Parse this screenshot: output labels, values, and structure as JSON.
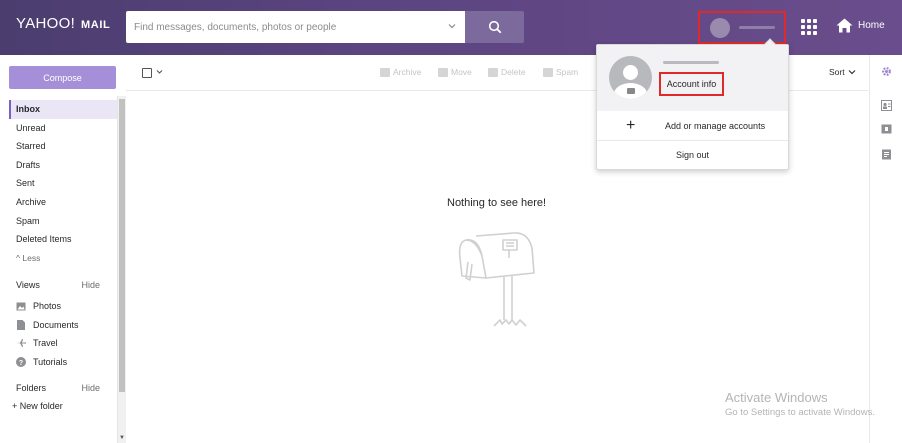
{
  "header": {
    "logo_text": "YAHOO!",
    "logo_mail": "MAIL",
    "search_placeholder": "Find messages, documents, photos or people",
    "home_label": "Home"
  },
  "sidebar": {
    "compose_label": "Compose",
    "items": [
      {
        "label": "Inbox",
        "active": true
      },
      {
        "label": "Unread"
      },
      {
        "label": "Starred"
      },
      {
        "label": "Drafts"
      },
      {
        "label": "Sent"
      },
      {
        "label": "Archive"
      },
      {
        "label": "Spam"
      },
      {
        "label": "Deleted Items"
      }
    ],
    "less_label": "Less",
    "views_label": "Views",
    "views_hide": "Hide",
    "views": [
      {
        "label": "Photos",
        "icon": "photo-icon"
      },
      {
        "label": "Documents",
        "icon": "document-icon"
      },
      {
        "label": "Travel",
        "icon": "plane-icon"
      },
      {
        "label": "Tutorials",
        "icon": "help-icon"
      }
    ],
    "folders_label": "Folders",
    "folders_hide": "Hide",
    "new_folder_label": "New folder"
  },
  "toolbar": {
    "archive": "Archive",
    "move": "Move",
    "delete": "Delete",
    "spam": "Spam",
    "sort": "Sort"
  },
  "main": {
    "empty_message": "Nothing to see here!"
  },
  "account_menu": {
    "account_info": "Account info",
    "add_manage": "Add or manage accounts",
    "sign_out": "Sign out"
  },
  "watermark": {
    "line1": "Activate Windows",
    "line2": "Go to Settings to activate Windows."
  },
  "colors": {
    "header": "#5b4480",
    "compose": "#a58fd9",
    "highlight_border": "#e02a2a"
  }
}
